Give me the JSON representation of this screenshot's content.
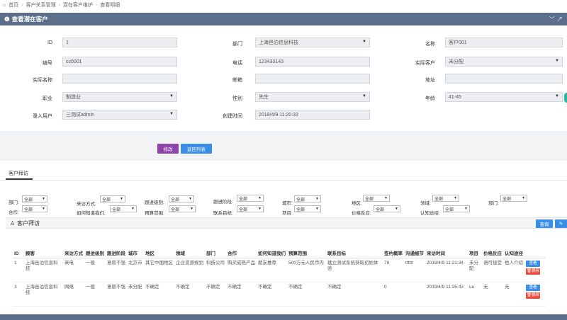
{
  "breadcrumb": {
    "items": [
      "首页",
      "客户关系管理",
      "潜在客户维护",
      "查看明细"
    ]
  },
  "panel": {
    "title": "查看潜在客户",
    "tools": "﹀ ↗"
  },
  "form": {
    "id_label": "ID",
    "id_value": "1",
    "dept_label": "部门",
    "dept_value": "上海邑泊信息科技",
    "name_label": "名称",
    "name_value": "客户001",
    "code_label": "编号",
    "code_value": "cc0001",
    "phone_label": "电话",
    "phone_value": "123433143",
    "real_client_label": "实际客户",
    "real_client_value": "未分配",
    "real_name_label": "实际名称",
    "real_name_value": "",
    "email_label": "邮箱",
    "email_value": "",
    "address_label": "地址",
    "address_value": "",
    "job_label": "职业",
    "job_value": "制造业",
    "gender_label": "性别",
    "gender_value": "先生",
    "age_label": "年龄",
    "age_value": "41-45",
    "entry_user_label": "录入用户",
    "entry_user_value": "三测试admin",
    "created_label": "创建时间",
    "created_value": "2019/4/9 11:20:33"
  },
  "actions": {
    "edit": "修改",
    "back": "返回列表"
  },
  "tab": {
    "label": "客户拜访"
  },
  "filters": {
    "row1": [
      {
        "label": "部门:",
        "value": "全部"
      },
      {
        "label": "来访方式:",
        "value": "全部"
      },
      {
        "label": "跟进级别:",
        "value": "全部"
      },
      {
        "label": "跟进阶段:",
        "value": "全部"
      },
      {
        "label": "城市:",
        "value": "全部"
      },
      {
        "label": "地区:",
        "value": "全部"
      },
      {
        "label": "领域:",
        "value": "全部"
      },
      {
        "label": "部门:",
        "value": "全部"
      }
    ],
    "row2": [
      {
        "label": "合作:",
        "value": "全部"
      },
      {
        "label": "如何知道我们:",
        "value": "全部"
      },
      {
        "label": "预算范围:",
        "value": "全部"
      },
      {
        "label": "联系目标:",
        "value": "全部"
      },
      {
        "label": "项目:",
        "value": "全部"
      },
      {
        "label": "价格反应:",
        "value": "全部"
      },
      {
        "label": "认知途径:",
        "value": "全部"
      }
    ]
  },
  "section": {
    "title": "客户拜访",
    "query": "查询",
    "edit_icon": "✎"
  },
  "table": {
    "headers": [
      "ID",
      "顾客",
      "来访方式",
      "跟进级别",
      "跟进阶段",
      "城市",
      "地区",
      "领域",
      "部门",
      "合作",
      "如何知道我们",
      "预算范围",
      "联系目标",
      "签约概率",
      "沟通细节",
      "来访时间",
      "项目",
      "价格反应",
      "认知途径",
      ""
    ],
    "rows": [
      {
        "cells": [
          "1",
          "上海邑泊信息科技",
          "来电",
          "一般",
          "意愿不强",
          "北京市",
          "其它中国地区",
          "企业资源规划",
          "科技公司",
          "购买成熟产品",
          "朋友推荐",
          "500万元人民币内",
          "建立测试系统获取初始体验",
          "78",
          "tttttt",
          "2019/4/9 11:21:34",
          "未分配",
          "语可接受",
          "他人介绍"
        ],
        "view": "查看",
        "delete": "删除"
      },
      {
        "cells": [
          "3",
          "上海邑泊信息科技",
          "网络",
          "一般",
          "意愿不强",
          "未分配",
          "不确定",
          "不确定",
          "不确定",
          "不确定",
          "不确定",
          "不确定",
          "不确定",
          "0",
          "",
          "2019/4/9 11:25:43",
          "uu",
          "无",
          "无"
        ],
        "view": "查看",
        "delete": "删除"
      }
    ]
  },
  "colors": {
    "header_bar": "#5b6f8a",
    "edit_button": "#8e44ad",
    "back_button": "#3a8ee6",
    "query_button": "#3a8ee6",
    "view_button": "#3a8ee6",
    "delete_button": "#e74c3c"
  }
}
